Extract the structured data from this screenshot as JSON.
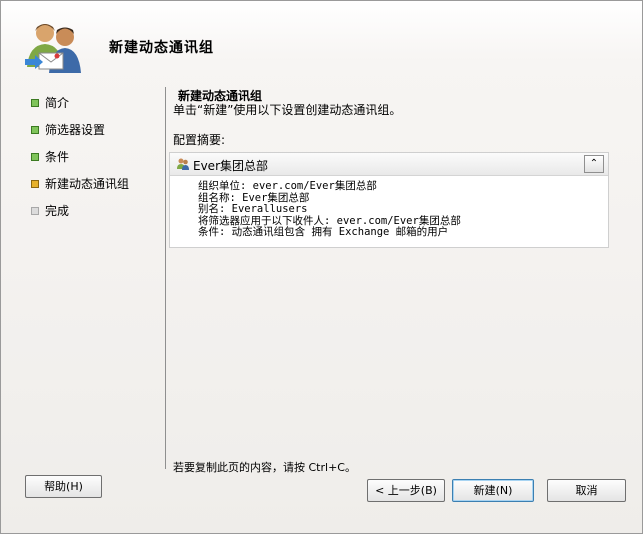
{
  "header": {
    "title": "新建动态通讯组"
  },
  "nav": {
    "items": [
      {
        "label": "简介",
        "state": "done"
      },
      {
        "label": "筛选器设置",
        "state": "done"
      },
      {
        "label": "条件",
        "state": "done"
      },
      {
        "label": "新建动态通讯组",
        "state": "current"
      },
      {
        "label": "完成",
        "state": "pending"
      }
    ]
  },
  "content": {
    "title": "新建动态通讯组",
    "description": "单击“新建”使用以下设置创建动态通讯组。",
    "config_label": "配置摘要:",
    "panel": {
      "name": "Ever集团总部",
      "lines": [
        "组织单位: ever.com/Ever集团总部",
        "组名称: Ever集团总部",
        "别名: Everallusers",
        "将筛选器应用于以下收件人: ever.com/Ever集团总部",
        "条件: 动态通讯组包含 拥有 Exchange 邮箱的用户"
      ]
    },
    "copy_hint": "若要复制此页的内容，请按 Ctrl+C。"
  },
  "buttons": {
    "help": "帮助(H)",
    "back": "< 上一步(B)",
    "next": "新建(N)",
    "cancel": "取消"
  },
  "colors": {
    "done": "#7fc45a",
    "current": "#e6b02a",
    "pending": "#dcdcdc"
  }
}
